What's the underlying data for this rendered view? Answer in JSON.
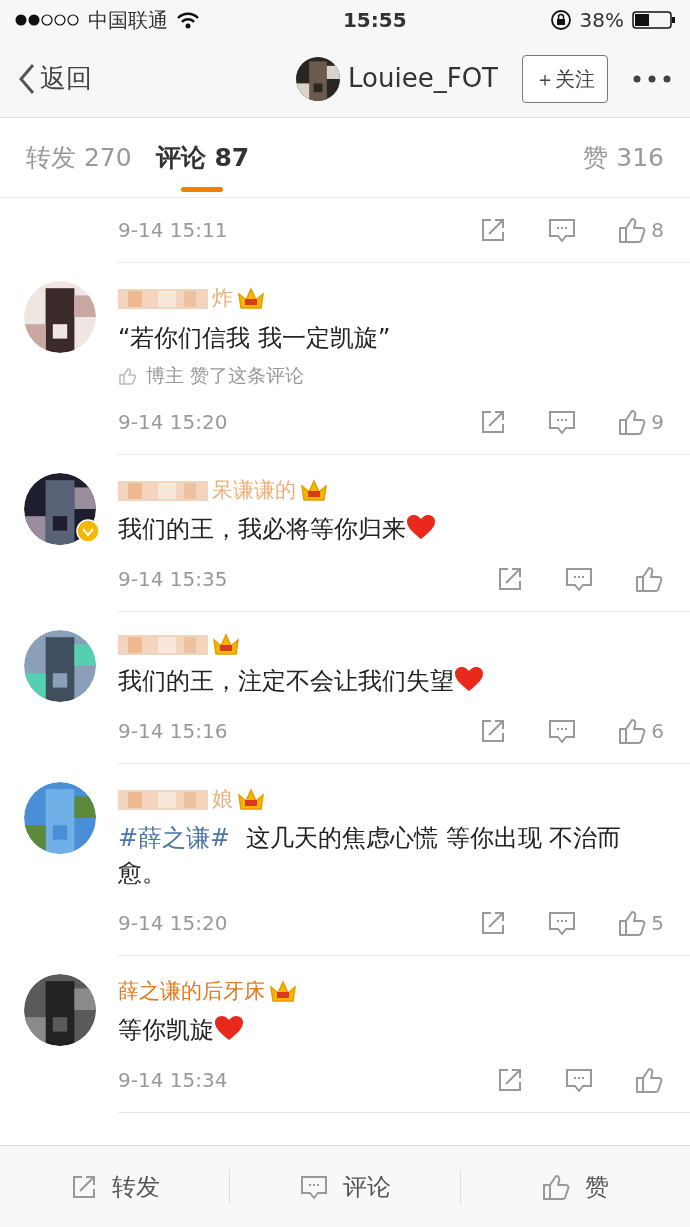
{
  "status_bar": {
    "carrier": "中国联通",
    "time": "15:55",
    "battery": "38%"
  },
  "nav": {
    "back": "返回",
    "username": "Louiee_FOT",
    "follow": "＋关注"
  },
  "tabs": [
    {
      "label": "转发 270",
      "selected": false
    },
    {
      "label": "评论 87",
      "selected": true
    },
    {
      "label": "赞 316",
      "selected": false
    }
  ],
  "comments": [
    {
      "time": "9-14 15:11",
      "likes": "8"
    },
    {
      "name": "炸",
      "redacted": true,
      "vip": true,
      "verified": false,
      "text": "“若你们信我 我一定凯旋”",
      "heart": false,
      "liked_by_author": "博主 赞了这条评论",
      "time": "9-14 15:20",
      "likes": "9"
    },
    {
      "name": "呆谦谦的",
      "redacted": true,
      "vip": true,
      "verified": true,
      "text": "我们的王，我必将等你归来",
      "heart": true,
      "time": "9-14 15:35"
    },
    {
      "redacted": true,
      "vip": true,
      "verified": false,
      "text": "我们的王，注定不会让我们失望",
      "heart": true,
      "time": "9-14 15:16",
      "likes": "6"
    },
    {
      "name": "娘",
      "redacted": true,
      "vip": true,
      "verified": false,
      "hashtag": "#薛之谦#",
      "text": "这几天的焦虑心慌 等你出现 不治而愈。",
      "heart": false,
      "time": "9-14 15:20",
      "likes": "5"
    },
    {
      "name": "薛之谦的后牙床",
      "redacted": false,
      "vip": true,
      "verified": false,
      "text": "等你凯旋",
      "heart": true,
      "time": "9-14 15:34"
    }
  ],
  "bottom_bar": [
    {
      "kind": "share",
      "label": "转发"
    },
    {
      "kind": "comment",
      "label": "评论"
    },
    {
      "kind": "like",
      "label": "赞"
    }
  ]
}
